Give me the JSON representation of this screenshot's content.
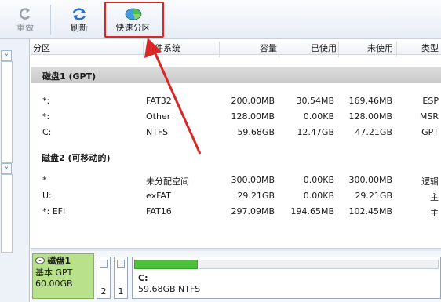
{
  "toolbar": {
    "redo_label": "重做",
    "refresh_label": "刷新",
    "quick_partition_label": "快速分区"
  },
  "columns": [
    "分区",
    "文件系统",
    "容量",
    "已使用",
    "未使用",
    "类型"
  ],
  "groups": [
    {
      "title": "磁盘1 (GPT)",
      "rows": [
        [
          "*:",
          "FAT32",
          "200.00MB",
          "30.54MB",
          "169.46MB",
          "ESP"
        ],
        [
          "*:",
          "Other",
          "128.00MB",
          "0.00KB",
          "128.00MB",
          "MSR"
        ],
        [
          "C:",
          "NTFS",
          "59.68GB",
          "12.47GB",
          "47.21GB",
          "GPT"
        ]
      ]
    },
    {
      "title": "磁盘2 (可移动的)",
      "rows": [
        [
          "*",
          "未分配空间",
          "300.00MB",
          "0.00KB",
          "300.00MB",
          "逻辑"
        ],
        [
          "U:",
          "exFAT",
          "29.21GB",
          "0.00KB",
          "29.21GB",
          "主"
        ],
        [
          "*: EFI",
          "FAT16",
          "297.09MB",
          "194.65MB",
          "102.45MB",
          "主"
        ]
      ]
    }
  ],
  "disk_map": {
    "disk_name": "磁盘1",
    "disk_type": "基本 GPT",
    "disk_size": "60.00GB",
    "mini_partitions": [
      "2",
      "1"
    ],
    "main_partition": {
      "label": "C:",
      "detail": "59.68GB NTFS",
      "used_fraction": 0.21
    }
  },
  "colors": {
    "highlight": "#d72727",
    "used_bar": "#4ec13a",
    "disk_info_bg": "#b9e08a"
  }
}
